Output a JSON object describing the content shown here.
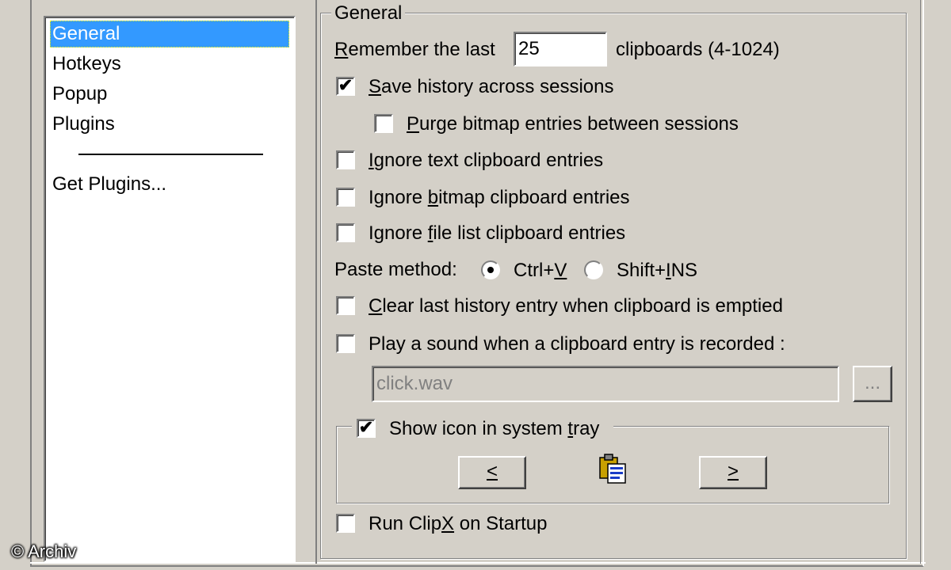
{
  "sidebar": {
    "items": [
      {
        "label": "General",
        "selected": true
      },
      {
        "label": "Hotkeys"
      },
      {
        "label": "Popup"
      },
      {
        "label": "Plugins"
      }
    ],
    "get_plugins": "Get Plugins..."
  },
  "general": {
    "legend": "General",
    "remember": {
      "pre": "R",
      "pre_rest": "emember the last",
      "value": "25",
      "post": "clipboards (4-1024)"
    },
    "save_history": {
      "u": "S",
      "rest": "ave history across sessions",
      "checked": true
    },
    "purge_bitmap": {
      "u": "P",
      "rest": "urge bitmap entries between sessions",
      "checked": false
    },
    "ignore_text": {
      "pre": "",
      "u": "I",
      "rest": "gnore text clipboard entries",
      "checked": false
    },
    "ignore_bitmap": {
      "pre": "Ignore ",
      "u": "b",
      "rest": "itmap clipboard entries",
      "checked": false
    },
    "ignore_filelist": {
      "pre": "Ignore ",
      "u": "f",
      "rest": "ile list clipboard entries",
      "checked": false
    },
    "paste_method": {
      "label": "Paste method:",
      "option1": {
        "pre": "Ctrl+",
        "u": "V",
        "selected": true
      },
      "option2": {
        "pre": "Shift+",
        "u": "I",
        "rest": "NS",
        "selected": false
      }
    },
    "clear_last": {
      "u": "C",
      "rest": "lear last history entry when clipboard is emptied",
      "checked": false
    },
    "play_sound": {
      "label": "Play a sound when a clipboard entry is recorded :",
      "checked": false
    },
    "sound_file": {
      "value": "click.wav",
      "browse": "..."
    },
    "tray": {
      "pre": "Show icon in system ",
      "u": "t",
      "rest": "ray",
      "checked": true,
      "prev": "<",
      "next": ">",
      "icon": "clipboard-icon"
    },
    "run_startup": {
      "pre": "Run Clip",
      "u": "X",
      "rest": " on Startup",
      "checked": false
    }
  },
  "watermark": "© Archiv",
  "colors": {
    "face": "#d4d0c8",
    "selection": "#3399ff"
  }
}
